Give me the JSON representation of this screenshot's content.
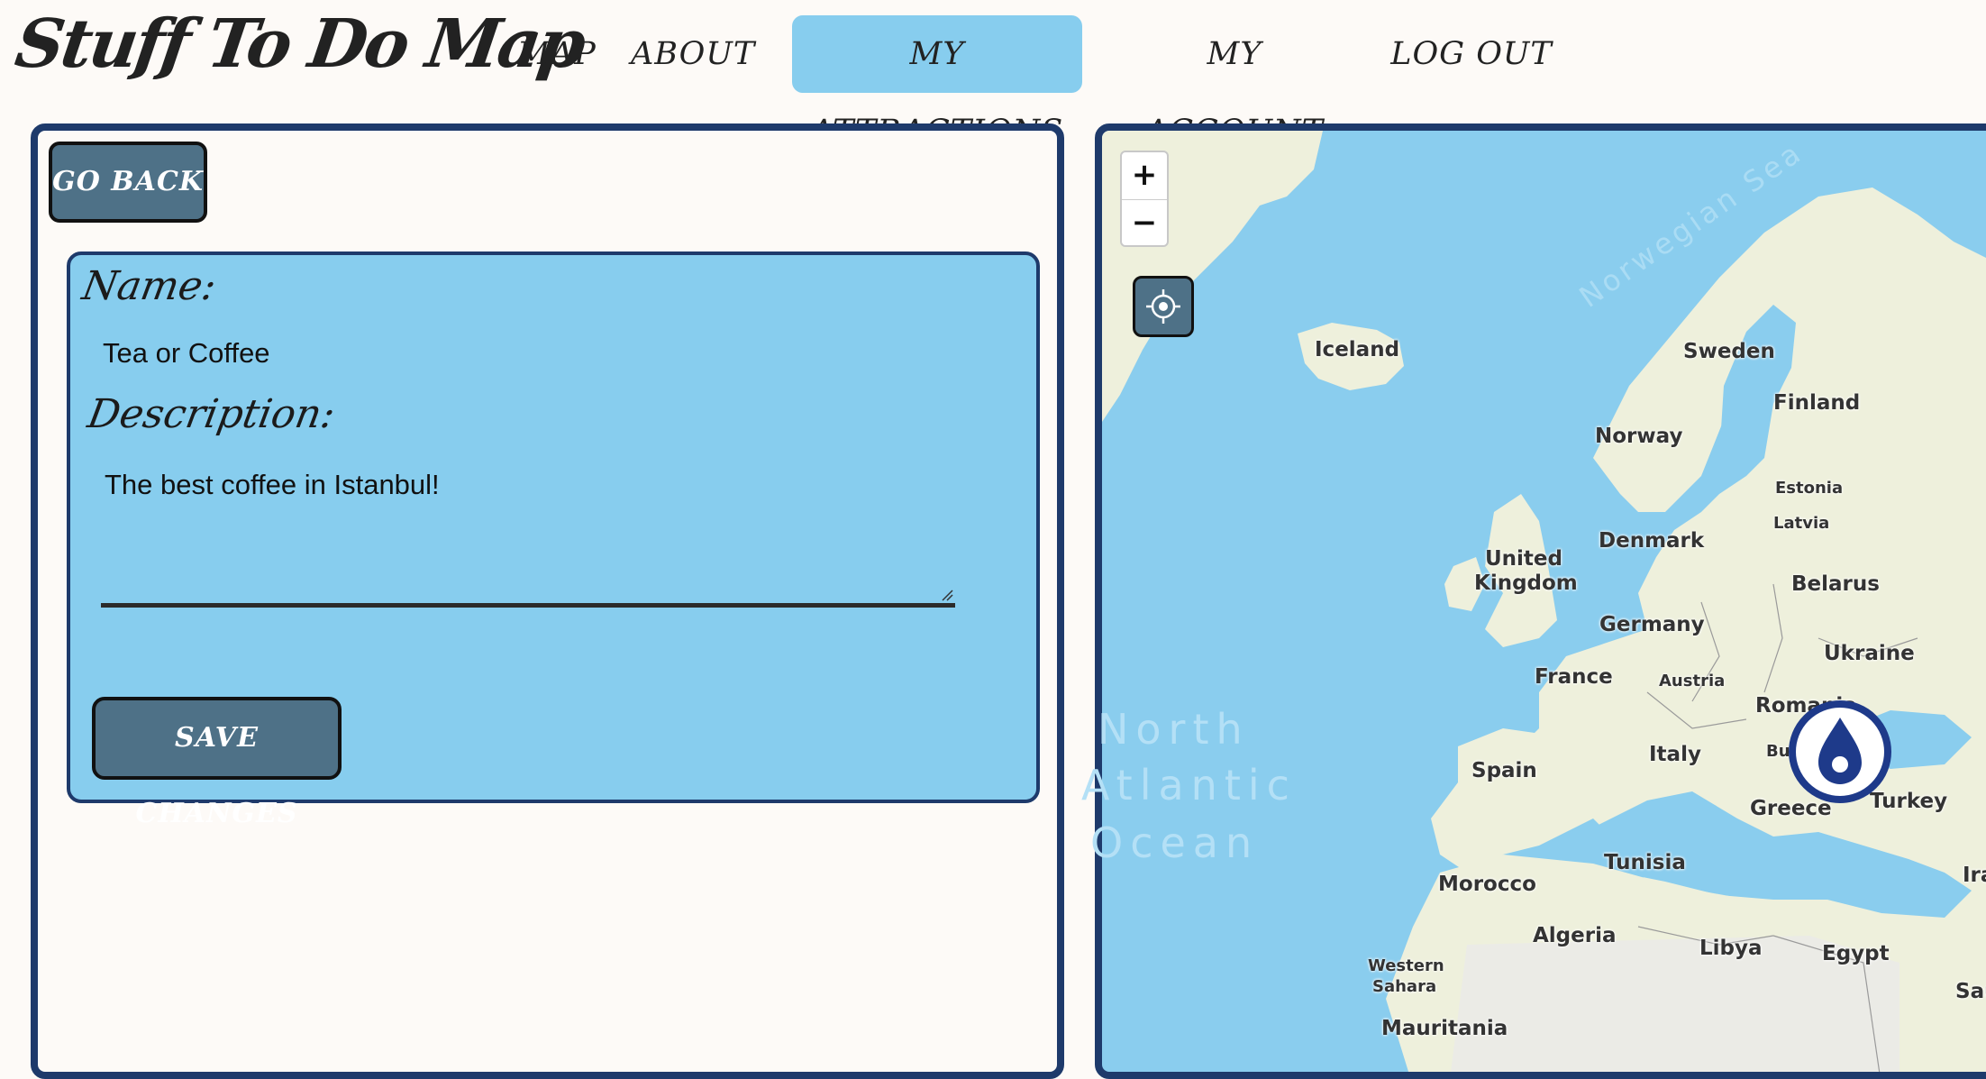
{
  "app": {
    "logo": "Stuff To Do Map"
  },
  "nav": {
    "items": [
      {
        "label": "MAP"
      },
      {
        "label": "ABOUT"
      },
      {
        "label": "MY ATTRACTIONS"
      },
      {
        "label": "MY ACCOUNT"
      },
      {
        "label": "LOG OUT"
      }
    ],
    "active": "MY ATTRACTIONS"
  },
  "editor": {
    "go_back_label": "GO BACK",
    "name_label": "Name:",
    "name_value": "Tea or Coffee",
    "description_label": "Description:",
    "description_value": "The best coffee in Istanbul!",
    "save_label": "SAVE CHANGES"
  },
  "map": {
    "zoom_in": "+",
    "zoom_out": "−",
    "labels": {
      "norwegian_sea": "Norwegian Sea",
      "iceland": "Iceland",
      "sweden": "Sweden",
      "finland": "Finland",
      "norway": "Norway",
      "estonia": "Estonia",
      "latvia": "Latvia",
      "denmark": "Denmark",
      "united_kingdom_1": "United",
      "united_kingdom_2": "Kingdom",
      "belarus": "Belarus",
      "germany": "Germany",
      "ukraine": "Ukraine",
      "france": "France",
      "austria": "Austria",
      "romania": "Romania",
      "spain": "Spain",
      "italy": "Italy",
      "bulgaria": "Bu",
      "greece": "Greece",
      "turkey": "Turkey",
      "tunisia": "Tunisia",
      "morocco": "Morocco",
      "algeria": "Algeria",
      "libya": "Libya",
      "egypt": "Egypt",
      "western_sahara_1": "Western",
      "western_sahara_2": "Sahara",
      "mauritania": "Mauritania",
      "iraq": "Ira",
      "saudi": "Saud",
      "ocean_1": "North",
      "ocean_2": "Atlantic",
      "ocean_3": "Ocean"
    }
  },
  "colors": {
    "accent": "#87cdee",
    "panel_border": "#1e3a6b",
    "button": "#4e7187",
    "marker": "#1e3a8a"
  }
}
